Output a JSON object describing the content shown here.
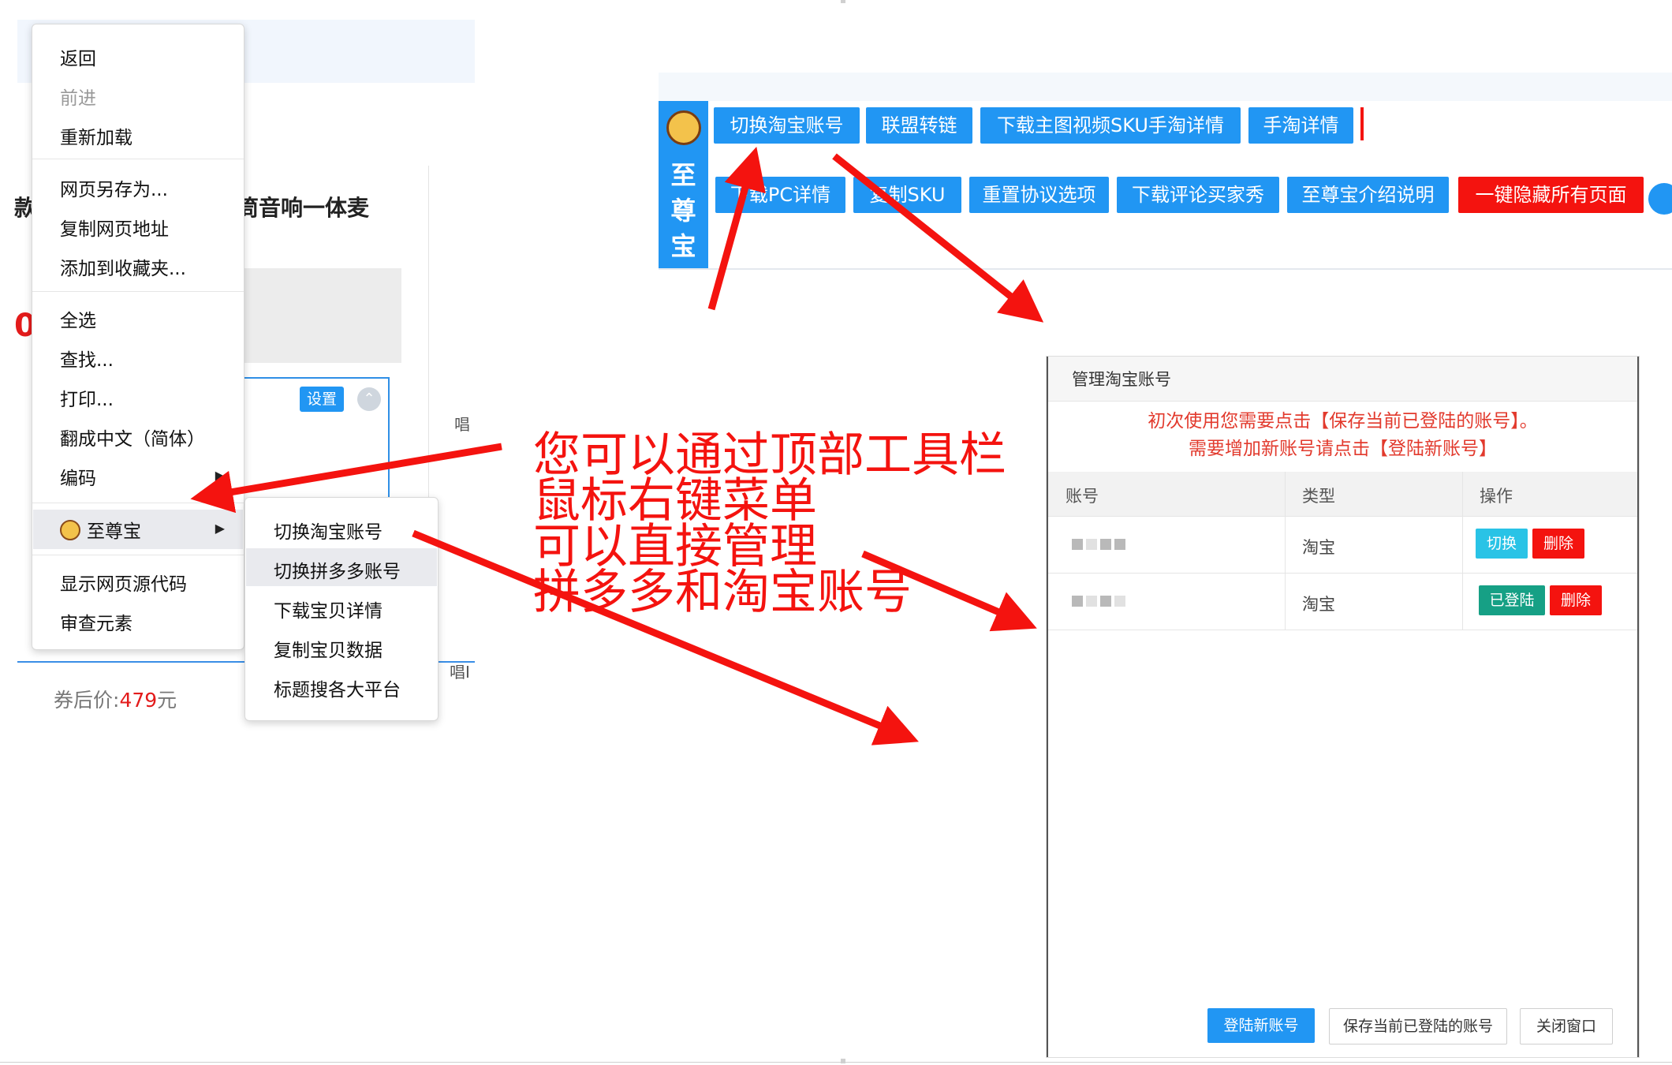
{
  "background_page": {
    "title_fragment": "筒音响一体麦",
    "left_fragment": "款",
    "price_fragment": "0.",
    "settings_button": "设置",
    "coupon_price_label": "券后价:",
    "coupon_price_value": "479",
    "coupon_price_unit": "元",
    "side_text_1": "唱",
    "side_text_2": "唱I"
  },
  "context_menu": {
    "items": [
      "返回",
      "前进",
      "重新加载",
      "网页另存为...",
      "复制网页地址",
      "添加到收藏夹...",
      "全选",
      "查找...",
      "打印...",
      "翻成中文（简体）",
      "编码",
      "至尊宝",
      "显示网页源代码",
      "审查元素"
    ]
  },
  "submenu": {
    "items": [
      "切换淘宝账号",
      "切换拼多多账号",
      "下载宝贝详情",
      "复制宝贝数据",
      "标题搜各大平台"
    ]
  },
  "toolbar": {
    "logo_text": "至尊宝",
    "row1": [
      "切换淘宝账号",
      "联盟转链",
      "下载主图视频SKU手淘详情",
      "手淘详情"
    ],
    "row2": [
      "下载PC详情",
      "复制SKU",
      "重置协议选项",
      "下载评论买家秀",
      "至尊宝介绍说明",
      "一键隐藏所有页面"
    ]
  },
  "annotation": {
    "lines": [
      "您可以通过顶部工具栏",
      "鼠标右键菜单",
      "可以直接管理",
      "拼多多和淘宝账号"
    ]
  },
  "dialog": {
    "title": "管理淘宝账号",
    "message_1": "初次使用您需要点击【保存当前已登陆的账号】。",
    "message_2": "需要增加新账号请点击【登陆新账号】",
    "columns": [
      "账号",
      "类型",
      "操作"
    ],
    "rows": [
      {
        "type": "淘宝",
        "action1": "切换",
        "action2": "删除"
      },
      {
        "type": "淘宝",
        "action1": "已登陆",
        "action2": "删除"
      }
    ],
    "buttons": [
      "登陆新账号",
      "保存当前已登陆的账号",
      "关闭窗口"
    ]
  },
  "colors": {
    "accent_blue": "#2196f3",
    "alert_red": "#f4130f",
    "switch_cyan": "#29c3e6",
    "logged_green": "#16a085"
  }
}
